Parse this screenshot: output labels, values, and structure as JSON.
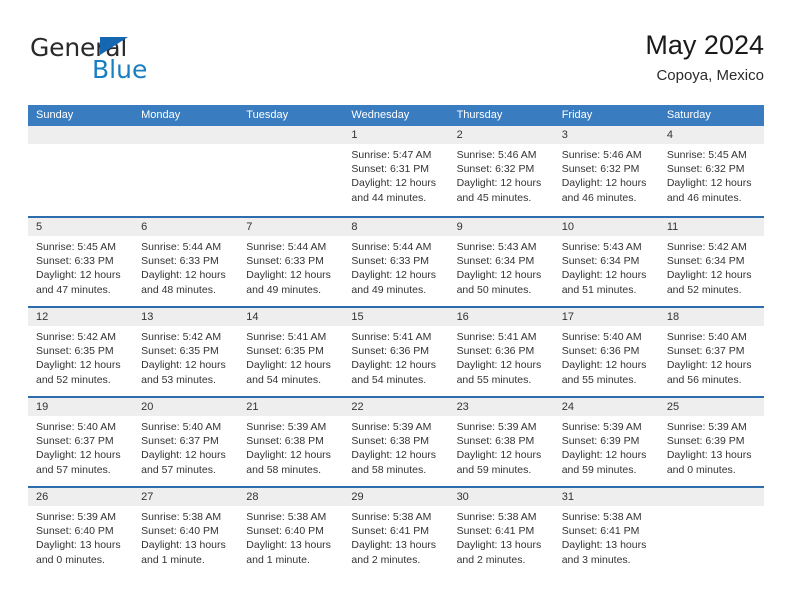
{
  "brand": {
    "name_part1": "General",
    "name_part2": "Blue",
    "flag_icon": "blue-triangle-flag-icon"
  },
  "header": {
    "title": "May 2024",
    "subtitle": "Copoya, Mexico"
  },
  "colors": {
    "header_blue": "#3a7cc0",
    "row_divider_blue": "#2e6cae",
    "day_band_gray": "#eeeeee",
    "brand_blue": "#1a7fc1",
    "text": "#333333"
  },
  "weekday_headers": [
    "Sunday",
    "Monday",
    "Tuesday",
    "Wednesday",
    "Thursday",
    "Friday",
    "Saturday"
  ],
  "weeks": [
    [
      {
        "day": "",
        "lines": []
      },
      {
        "day": "",
        "lines": []
      },
      {
        "day": "",
        "lines": []
      },
      {
        "day": "1",
        "lines": [
          "Sunrise: 5:47 AM",
          "Sunset: 6:31 PM",
          "Daylight: 12 hours",
          "and 44 minutes."
        ]
      },
      {
        "day": "2",
        "lines": [
          "Sunrise: 5:46 AM",
          "Sunset: 6:32 PM",
          "Daylight: 12 hours",
          "and 45 minutes."
        ]
      },
      {
        "day": "3",
        "lines": [
          "Sunrise: 5:46 AM",
          "Sunset: 6:32 PM",
          "Daylight: 12 hours",
          "and 46 minutes."
        ]
      },
      {
        "day": "4",
        "lines": [
          "Sunrise: 5:45 AM",
          "Sunset: 6:32 PM",
          "Daylight: 12 hours",
          "and 46 minutes."
        ]
      }
    ],
    [
      {
        "day": "5",
        "lines": [
          "Sunrise: 5:45 AM",
          "Sunset: 6:33 PM",
          "Daylight: 12 hours",
          "and 47 minutes."
        ]
      },
      {
        "day": "6",
        "lines": [
          "Sunrise: 5:44 AM",
          "Sunset: 6:33 PM",
          "Daylight: 12 hours",
          "and 48 minutes."
        ]
      },
      {
        "day": "7",
        "lines": [
          "Sunrise: 5:44 AM",
          "Sunset: 6:33 PM",
          "Daylight: 12 hours",
          "and 49 minutes."
        ]
      },
      {
        "day": "8",
        "lines": [
          "Sunrise: 5:44 AM",
          "Sunset: 6:33 PM",
          "Daylight: 12 hours",
          "and 49 minutes."
        ]
      },
      {
        "day": "9",
        "lines": [
          "Sunrise: 5:43 AM",
          "Sunset: 6:34 PM",
          "Daylight: 12 hours",
          "and 50 minutes."
        ]
      },
      {
        "day": "10",
        "lines": [
          "Sunrise: 5:43 AM",
          "Sunset: 6:34 PM",
          "Daylight: 12 hours",
          "and 51 minutes."
        ]
      },
      {
        "day": "11",
        "lines": [
          "Sunrise: 5:42 AM",
          "Sunset: 6:34 PM",
          "Daylight: 12 hours",
          "and 52 minutes."
        ]
      }
    ],
    [
      {
        "day": "12",
        "lines": [
          "Sunrise: 5:42 AM",
          "Sunset: 6:35 PM",
          "Daylight: 12 hours",
          "and 52 minutes."
        ]
      },
      {
        "day": "13",
        "lines": [
          "Sunrise: 5:42 AM",
          "Sunset: 6:35 PM",
          "Daylight: 12 hours",
          "and 53 minutes."
        ]
      },
      {
        "day": "14",
        "lines": [
          "Sunrise: 5:41 AM",
          "Sunset: 6:35 PM",
          "Daylight: 12 hours",
          "and 54 minutes."
        ]
      },
      {
        "day": "15",
        "lines": [
          "Sunrise: 5:41 AM",
          "Sunset: 6:36 PM",
          "Daylight: 12 hours",
          "and 54 minutes."
        ]
      },
      {
        "day": "16",
        "lines": [
          "Sunrise: 5:41 AM",
          "Sunset: 6:36 PM",
          "Daylight: 12 hours",
          "and 55 minutes."
        ]
      },
      {
        "day": "17",
        "lines": [
          "Sunrise: 5:40 AM",
          "Sunset: 6:36 PM",
          "Daylight: 12 hours",
          "and 55 minutes."
        ]
      },
      {
        "day": "18",
        "lines": [
          "Sunrise: 5:40 AM",
          "Sunset: 6:37 PM",
          "Daylight: 12 hours",
          "and 56 minutes."
        ]
      }
    ],
    [
      {
        "day": "19",
        "lines": [
          "Sunrise: 5:40 AM",
          "Sunset: 6:37 PM",
          "Daylight: 12 hours",
          "and 57 minutes."
        ]
      },
      {
        "day": "20",
        "lines": [
          "Sunrise: 5:40 AM",
          "Sunset: 6:37 PM",
          "Daylight: 12 hours",
          "and 57 minutes."
        ]
      },
      {
        "day": "21",
        "lines": [
          "Sunrise: 5:39 AM",
          "Sunset: 6:38 PM",
          "Daylight: 12 hours",
          "and 58 minutes."
        ]
      },
      {
        "day": "22",
        "lines": [
          "Sunrise: 5:39 AM",
          "Sunset: 6:38 PM",
          "Daylight: 12 hours",
          "and 58 minutes."
        ]
      },
      {
        "day": "23",
        "lines": [
          "Sunrise: 5:39 AM",
          "Sunset: 6:38 PM",
          "Daylight: 12 hours",
          "and 59 minutes."
        ]
      },
      {
        "day": "24",
        "lines": [
          "Sunrise: 5:39 AM",
          "Sunset: 6:39 PM",
          "Daylight: 12 hours",
          "and 59 minutes."
        ]
      },
      {
        "day": "25",
        "lines": [
          "Sunrise: 5:39 AM",
          "Sunset: 6:39 PM",
          "Daylight: 13 hours",
          "and 0 minutes."
        ]
      }
    ],
    [
      {
        "day": "26",
        "lines": [
          "Sunrise: 5:39 AM",
          "Sunset: 6:40 PM",
          "Daylight: 13 hours",
          "and 0 minutes."
        ]
      },
      {
        "day": "27",
        "lines": [
          "Sunrise: 5:38 AM",
          "Sunset: 6:40 PM",
          "Daylight: 13 hours",
          "and 1 minute."
        ]
      },
      {
        "day": "28",
        "lines": [
          "Sunrise: 5:38 AM",
          "Sunset: 6:40 PM",
          "Daylight: 13 hours",
          "and 1 minute."
        ]
      },
      {
        "day": "29",
        "lines": [
          "Sunrise: 5:38 AM",
          "Sunset: 6:41 PM",
          "Daylight: 13 hours",
          "and 2 minutes."
        ]
      },
      {
        "day": "30",
        "lines": [
          "Sunrise: 5:38 AM",
          "Sunset: 6:41 PM",
          "Daylight: 13 hours",
          "and 2 minutes."
        ]
      },
      {
        "day": "31",
        "lines": [
          "Sunrise: 5:38 AM",
          "Sunset: 6:41 PM",
          "Daylight: 13 hours",
          "and 3 minutes."
        ]
      },
      {
        "day": "",
        "lines": []
      }
    ]
  ]
}
